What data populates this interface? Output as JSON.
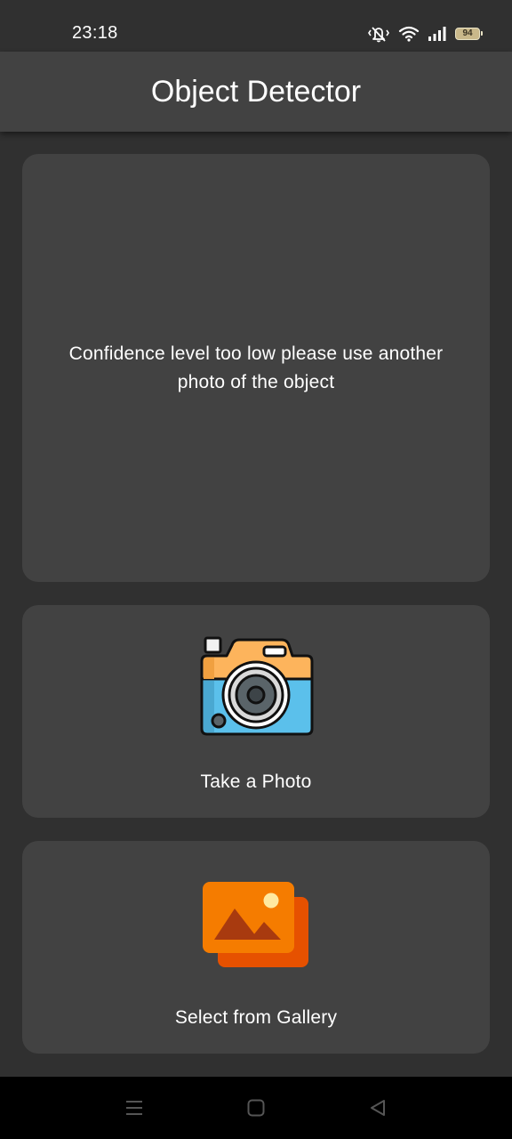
{
  "status_bar": {
    "time": "23:18",
    "battery_level": "94",
    "icons": [
      "mute-vibrate-icon",
      "wifi-icon",
      "signal-icon",
      "battery-icon"
    ]
  },
  "app_bar": {
    "title": "Object Detector"
  },
  "result": {
    "message": "Confidence level too low please use another photo of the object"
  },
  "actions": {
    "take_photo_label": "Take a Photo",
    "gallery_label": "Select from Gallery"
  },
  "nav_bar": {
    "icons": [
      "menu-icon",
      "home-icon",
      "back-icon"
    ]
  },
  "colors": {
    "background": "#303030",
    "surface": "#424242",
    "app_bar": "#424242",
    "camera_top": "#FDB45C",
    "camera_bottom": "#5BC0EB",
    "gallery_front": "#F57C00",
    "gallery_back": "#E65100"
  }
}
